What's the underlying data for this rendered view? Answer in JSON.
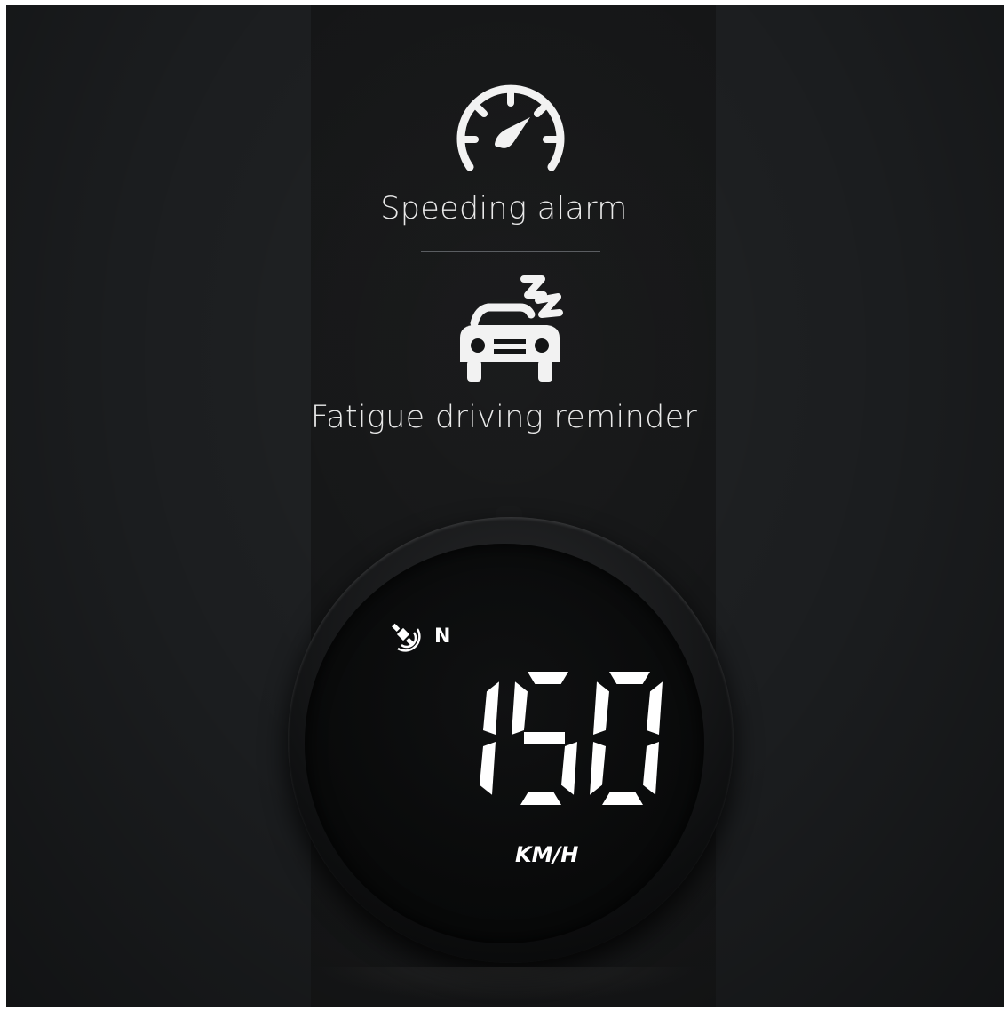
{
  "features": [
    {
      "icon": "speedometer-icon",
      "label": "Speeding alarm"
    },
    {
      "icon": "sleeping-car-icon",
      "label": "Fatigue driving reminder"
    }
  ],
  "device": {
    "gps_icon": "satellite-icon",
    "direction": "N",
    "speed": "150",
    "unit": "KM/H"
  },
  "colors": {
    "background": "#1b1d1f",
    "center_band": "#141516",
    "text": "#e9e9e9",
    "display": "#ffffff"
  }
}
